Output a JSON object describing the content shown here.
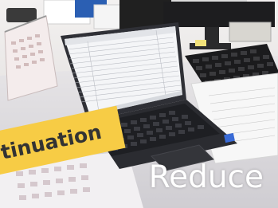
{
  "image": {
    "description_icon": "office-desk-photo-icon",
    "banner_text": "tinuation",
    "caption_text": "Reduce",
    "colors": {
      "banner": "#f7cc45",
      "banner_text": "#333333",
      "caption_text": "#ffffff",
      "laptop_body": "#2f3036",
      "keyboard": "#222326",
      "desk": "#e9e7ea"
    }
  }
}
